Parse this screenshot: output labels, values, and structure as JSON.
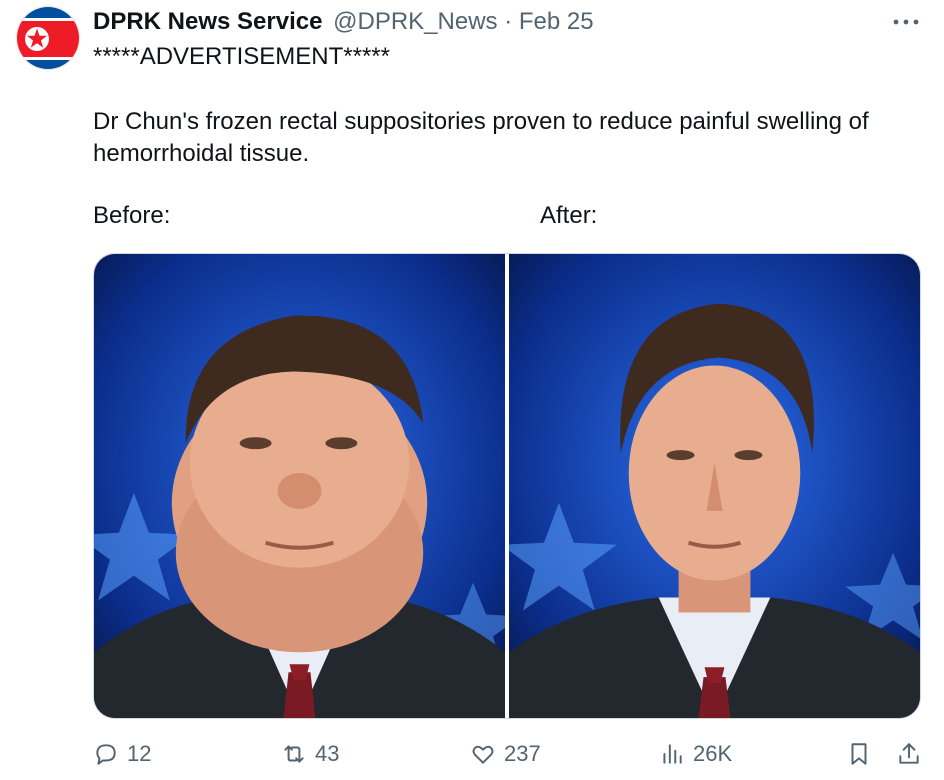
{
  "tweet": {
    "author_name": "DPRK News Service",
    "handle": "@DPRK_News",
    "separator": "·",
    "date": "Feb 25",
    "line1": "*****ADVERTISEMENT*****",
    "line2": "Dr Chun's frozen rectal suppositories proven to reduce painful swelling of",
    "line3": "hemorrhoidal tissue.",
    "before_label": "Before:",
    "after_label": "After:"
  },
  "actions": {
    "replies": "12",
    "reposts": "43",
    "likes": "237",
    "views": "26K"
  },
  "icons": {
    "avatar": "north-korea-flag",
    "more": "more-icon",
    "reply": "reply-icon",
    "repost": "repost-icon",
    "like": "heart-icon",
    "views": "views-icon",
    "bookmark": "bookmark-icon",
    "share": "share-icon"
  },
  "colors": {
    "flag_blue": "#024fa2",
    "flag_red": "#ed1c27",
    "text_secondary": "#536471"
  }
}
